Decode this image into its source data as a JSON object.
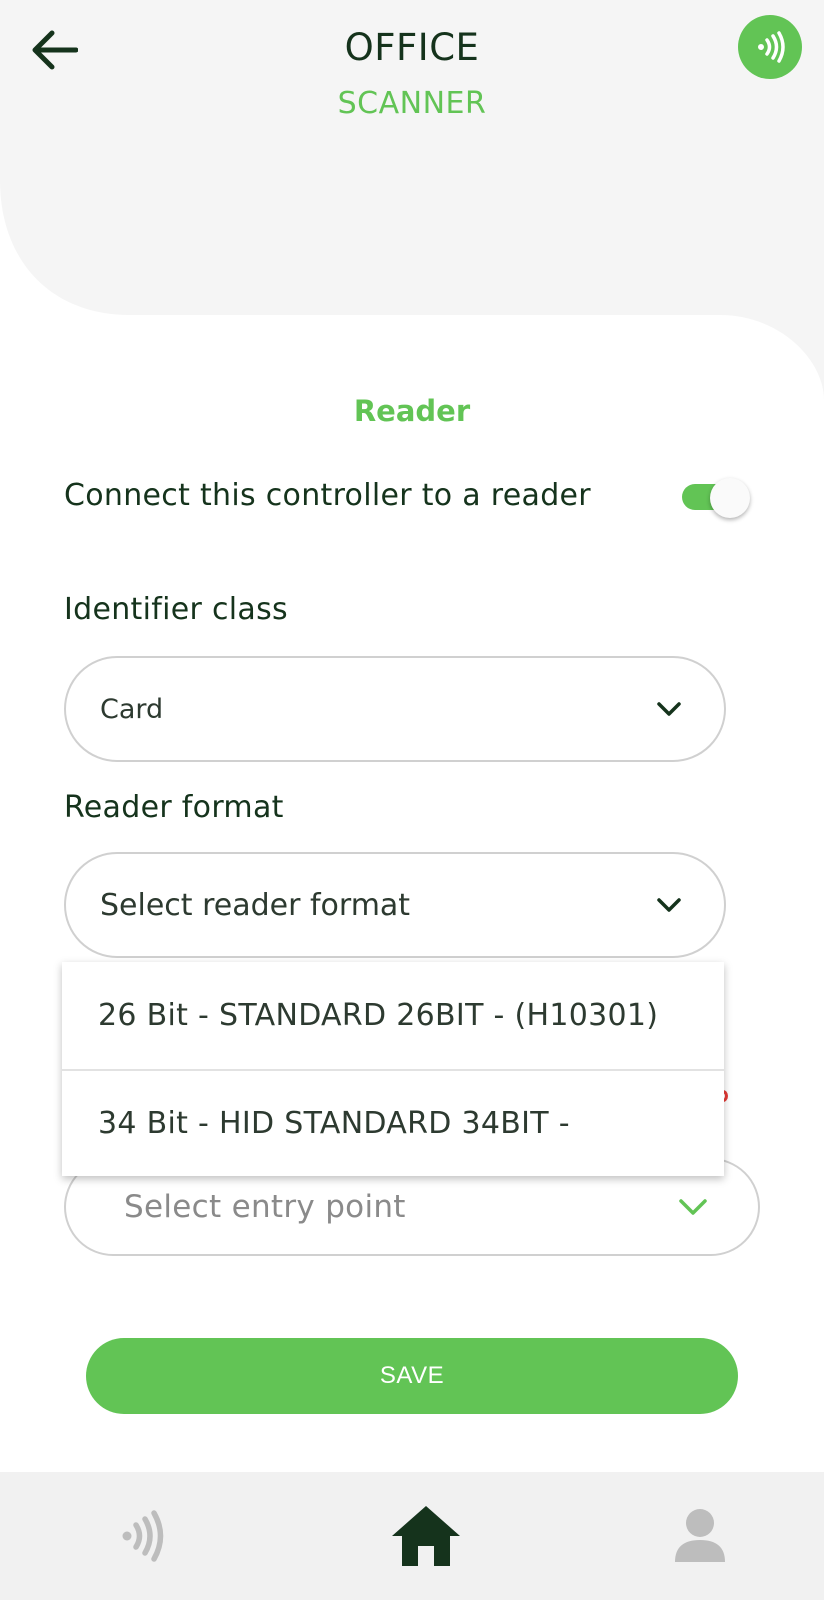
{
  "header": {
    "title": "OFFICE",
    "subtitle": "SCANNER",
    "back_icon": "arrow-left-icon",
    "badge_icon": "nfc-icon"
  },
  "section": {
    "title": "Reader",
    "connect_label": "Connect this controller to a reader",
    "connect_enabled": true
  },
  "identifier_class": {
    "label": "Identifier class",
    "value": "Card"
  },
  "reader_format": {
    "label": "Reader format",
    "placeholder": "Select reader format",
    "options": [
      "26 Bit - STANDARD 26BIT - (H10301)",
      "34 Bit - HID STANDARD 34BIT -"
    ]
  },
  "entry_point": {
    "placeholder": "Select entry point"
  },
  "save_label": "SAVE",
  "bottom_nav": {
    "items": [
      "nfc-icon",
      "home-icon",
      "user-icon"
    ],
    "active": "home-icon"
  },
  "colors": {
    "accent": "#62c455",
    "dark": "#15331c",
    "nav_inactive": "#bdbdbd"
  }
}
